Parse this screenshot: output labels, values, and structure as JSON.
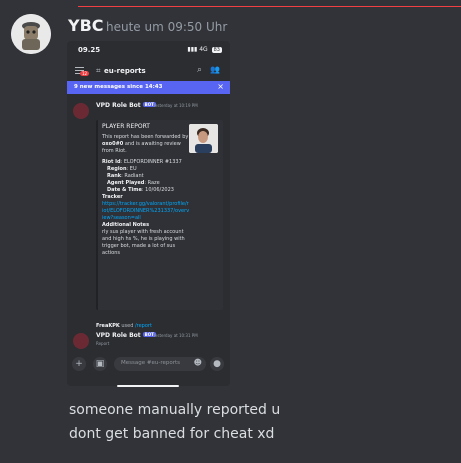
{
  "message": {
    "author": "YBC",
    "timestamp": "heute um 09:50 Uhr",
    "lines": [
      "someone manually reported u",
      "dont get banned for cheat xd"
    ]
  },
  "screenshot": {
    "status_time": "09.25",
    "status_icons": "4G",
    "battery": "83",
    "channel_name": "eu-reports",
    "notification_badge": "12",
    "new_messages": "9 new messages since 14:43",
    "first_message": {
      "bot_name": "VPD Role Bot",
      "bot_tag": "BOT",
      "time": "Yesterday at 10:19 PM",
      "embed": {
        "title": "PLAYER REPORT",
        "intro_a": "This report has been forwarded by ",
        "reporter": "oxo0#0",
        "intro_b": " and is awaiting review from Riot.",
        "riot_id_label": "Riot Id",
        "riot_id_value": ": ELOFORDINNER #1337",
        "region_label": "Region",
        "region_value": ": EU",
        "rank_label": "Rank",
        "rank_value": ": Radiant",
        "agent_label": "Agent Played",
        "agent_value": ": Raze",
        "date_label": "Date & Time",
        "date_value": ": 10/06/2023",
        "tracker_label": "Tracker",
        "tracker_url": "https://tracker.gg/valorant/profile/riot/ELOFORDINNER%231337/overview?season=all",
        "notes_label": "Additional Notes",
        "notes_value": "rly sus player with fresh account and high hs %, he is playing with trigger bot, made a lot of sus actions"
      }
    },
    "slash": {
      "user": "FreaKPK",
      "used": " used ",
      "command": "/report"
    },
    "second_message": {
      "bot_name": "VPD Role Bot",
      "bot_tag": "BOT",
      "time": "Yesterday at 10:31 PM",
      "sub": "Report"
    },
    "input_placeholder": "Message #eu-reports"
  }
}
